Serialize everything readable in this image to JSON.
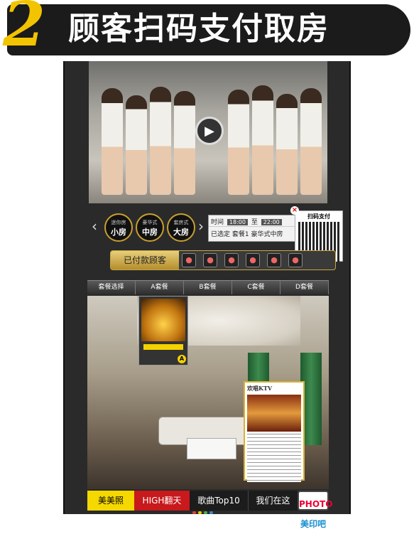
{
  "header": {
    "step_number": "2",
    "title": "顾客扫码支付取房"
  },
  "rooms": [
    {
      "sub": "迷你房",
      "main": "小房"
    },
    {
      "sub": "豪华式",
      "main": "中房"
    },
    {
      "sub": "套房式",
      "main": "大房"
    }
  ],
  "time": {
    "label": "时间",
    "start": "18:00",
    "to": "至",
    "end": "22:00",
    "selected_label": "已选定",
    "selected_pkg": "套餐1",
    "selected_room": "豪华式中房"
  },
  "qr": {
    "title": "扫码支付"
  },
  "paid": {
    "label": "已付款顾客"
  },
  "tabs": [
    "套餐选择",
    "A套餐",
    "B套餐",
    "C套餐",
    "D套餐"
  ],
  "drink_badge": "A",
  "ktv_card": {
    "title": "欢唱KTV"
  },
  "nav": {
    "item1": "美美照",
    "item2": "HIGH翻天",
    "item3": "歌曲Top10",
    "item4": "我们在这",
    "item5_top": "PHOTO",
    "item5_bottom": "美印吧"
  },
  "colors": {
    "accent": "#f2c400",
    "nav_red": "#c8191c",
    "gold": "#c9a640"
  }
}
